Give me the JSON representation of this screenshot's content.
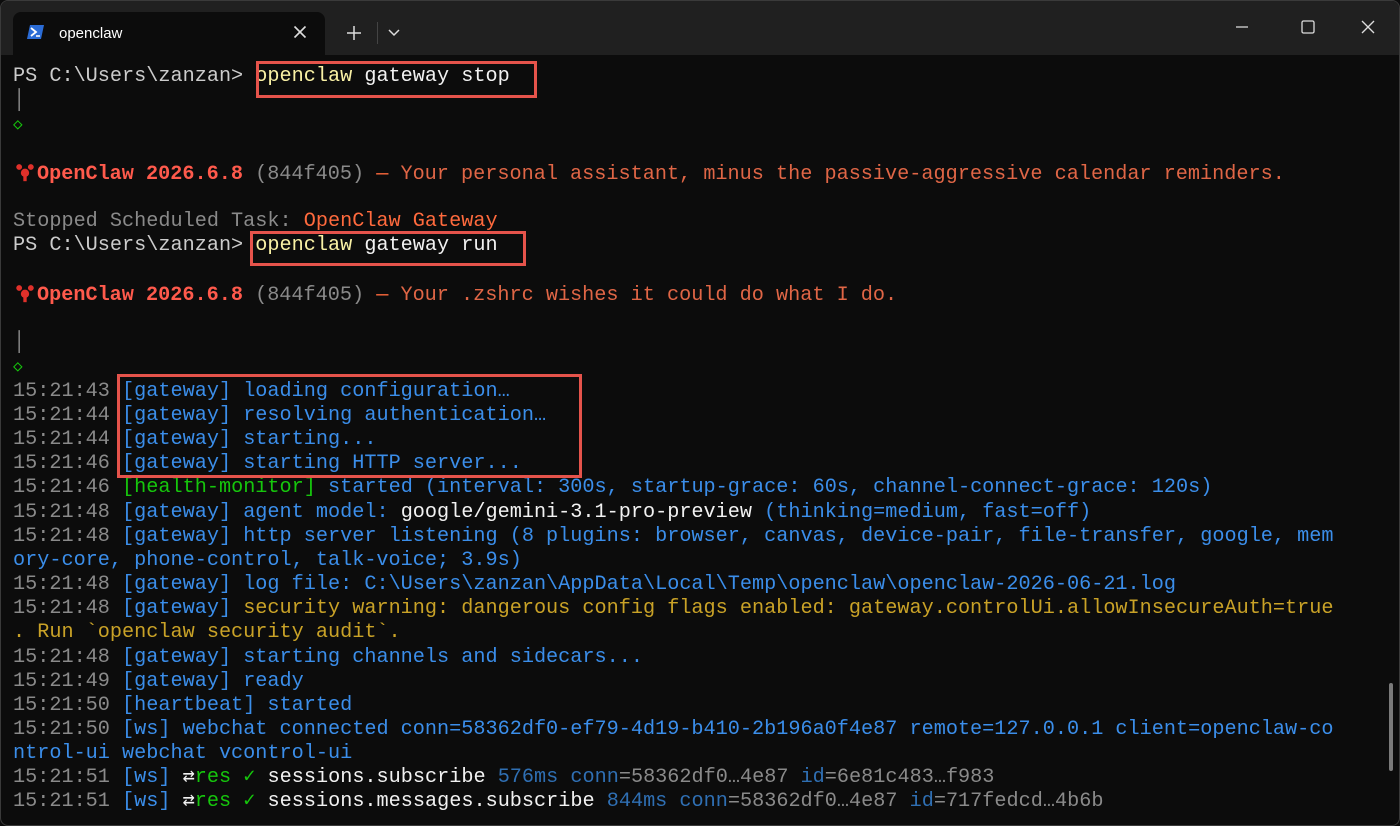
{
  "window": {
    "tab_title": "openclaw",
    "new_tab_symbol": "+",
    "icons": {
      "tab": "powershell-icon",
      "close": "close-icon",
      "dropdown": "chevron-down-icon"
    }
  },
  "colors": {
    "accent_highlight": "#e5534b",
    "gateway_blue": "#3b8eea",
    "brand_red": "#ff5a4c",
    "tagline_orange": "#e06646",
    "warning_yellow": "#c9a227"
  },
  "terminal": {
    "l1": {
      "prompt": "PS C:\\Users\\zanzan> ",
      "cmd1": "openclaw",
      "cmd2": " gateway stop"
    },
    "bar1": "│",
    "diamond1": "◇",
    "l4": {
      "name": "OpenClaw",
      "version": " 2026.6.8 ",
      "hash": "(844f405)",
      "dash": " — ",
      "tagline": "Your personal assistant, minus the passive-aggressive calendar reminders."
    },
    "l5": {
      "text": "Stopped Scheduled Task: ",
      "task": "OpenClaw Gateway"
    },
    "l6": {
      "prompt": "PS C:\\Users\\zanzan> ",
      "cmd1": "openclaw",
      "cmd2": " gateway run"
    },
    "l7": {
      "name": "OpenClaw",
      "version": " 2026.6.8 ",
      "hash": "(844f405)",
      "dash": " — ",
      "tagline": "Your .zshrc wishes it could do what I do."
    },
    "bar2": "│",
    "diamond2": "◇",
    "logs": [
      {
        "time": "15:21:43",
        "text": "[gateway] loading configuration…"
      },
      {
        "time": "15:21:44",
        "text": "[gateway] resolving authentication…"
      },
      {
        "time": "15:21:44",
        "text": "[gateway] starting..."
      },
      {
        "time": "15:21:46",
        "text": "[gateway] starting HTTP server..."
      }
    ],
    "health": {
      "time": "15:21:46",
      "tag": "[health-monitor]",
      "text": " started (interval: 300s, startup-grace: 60s, channel-connect-grace: 120s)"
    },
    "model": {
      "time": "15:21:48",
      "tag": "[gateway] agent model: ",
      "model": "google/gemini-3.1-pro-preview",
      "rest": " (thinking=medium, fast=off)"
    },
    "http": {
      "time": "15:21:48",
      "text1": "[gateway] http server listening (8 plugins: browser, canvas, device-pair, file-transfer, google, mem",
      "text2": "ory-core, phone-control, talk-voice; 3.9s)"
    },
    "logfile": {
      "time": "15:21:48",
      "text": "[gateway] log file: C:\\Users\\zanzan\\AppData\\Local\\Temp\\openclaw\\openclaw-2026-06-21.log"
    },
    "security": {
      "time": "15:21:48",
      "tag": "[gateway]",
      "text1": " security warning: dangerous config flags enabled: gateway.controlUi.allowInsecureAuth=true",
      "text2": ". Run `openclaw security audit`."
    },
    "channels": {
      "time": "15:21:48",
      "text": "[gateway] starting channels and sidecars..."
    },
    "ready": {
      "time": "15:21:49",
      "text": "[gateway] ready"
    },
    "heartbeat": {
      "time": "15:21:50",
      "text": "[heartbeat] started"
    },
    "ws1": {
      "time": "15:21:50",
      "text1": "[ws] webchat connected conn=58362df0-ef79-4d19-b410-2b196a0f4e87 remote=127.0.0.1 client=openclaw-co",
      "text2": "ntrol-ui webchat vcontrol-ui"
    },
    "ws2": {
      "time": "15:21:51",
      "tag": "[ws] ",
      "arrow": "⇄",
      "res": "res ✓ ",
      "method": "sessions.subscribe",
      "ms": " 576ms",
      "connk": " conn",
      "connv": "=58362df0…4e87",
      "idk": " id",
      "idv": "=6e81c483…f983"
    },
    "ws3": {
      "time": "15:21:51",
      "tag": "[ws] ",
      "arrow": "⇄",
      "res": "res ✓ ",
      "method": "sessions.messages.subscribe",
      "ms": " 844ms",
      "connk": " conn",
      "connv": "=58362df0…4e87",
      "idk": " id",
      "idv": "=717fedcd…4b6b"
    }
  }
}
